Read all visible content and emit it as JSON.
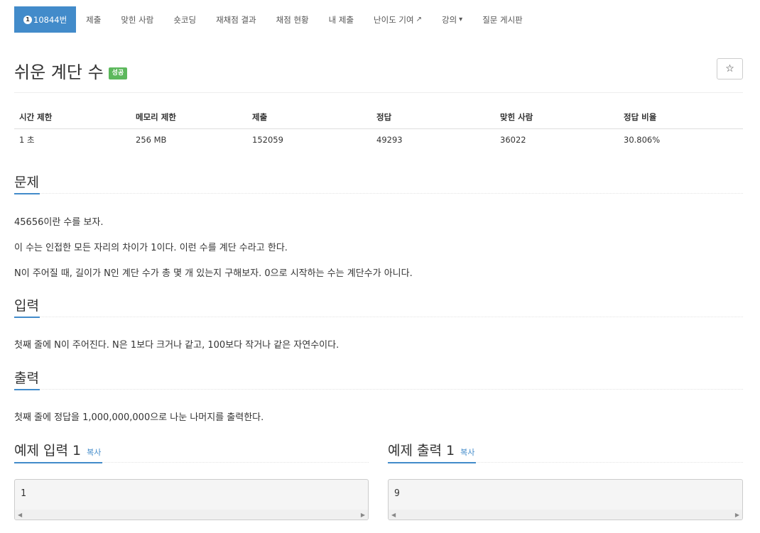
{
  "nav": {
    "problem_number": "10844번",
    "tier_badge": "1",
    "items": [
      "제출",
      "맞힌 사람",
      "숏코딩",
      "재채점 결과",
      "채점 현황",
      "내 제출",
      "난이도 기여",
      "강의",
      "질문 게시판"
    ]
  },
  "title": {
    "text": "쉬운 계단 수",
    "badge": "성공"
  },
  "table": {
    "headers": [
      "시간 제한",
      "메모리 제한",
      "제출",
      "정답",
      "맞힌 사람",
      "정답 비율"
    ],
    "values": [
      "1 초",
      "256 MB",
      "152059",
      "49293",
      "36022",
      "30.806%"
    ]
  },
  "problem": {
    "heading": "문제",
    "lines": [
      "45656이란 수를 보자.",
      "이 수는 인접한 모든 자리의 차이가 1이다. 이런 수를 계단 수라고 한다.",
      "N이 주어질 때, 길이가 N인 계단 수가 총 몇 개 있는지 구해보자. 0으로 시작하는 수는 계단수가 아니다."
    ]
  },
  "input": {
    "heading": "입력",
    "text": "첫째 줄에 N이 주어진다. N은 1보다 크거나 같고, 100보다 작거나 같은 자연수이다."
  },
  "output": {
    "heading": "출력",
    "text": "첫째 줄에 정답을 1,000,000,000으로 나눈 나머지를 출력한다."
  },
  "samples": {
    "input_heading": "예제 입력 1",
    "output_heading": "예제 출력 1",
    "copy_label": "복사",
    "input_value": "1",
    "output_value": "9"
  },
  "colors": {
    "accent": "#428bca",
    "success": "#5cb85c"
  },
  "icons": [
    "external-link-icon",
    "caret-down-icon",
    "star-icon",
    "scroll-left-icon",
    "scroll-right-icon"
  ]
}
